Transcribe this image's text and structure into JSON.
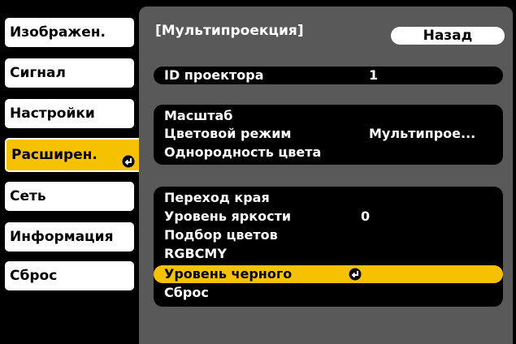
{
  "tabs": [
    {
      "label": "Изображен.",
      "active": false
    },
    {
      "label": "Сигнал",
      "active": false
    },
    {
      "label": "Настройки",
      "active": false
    },
    {
      "label": "Расширен.",
      "active": true
    },
    {
      "label": "Сеть",
      "active": false
    },
    {
      "label": "Информация",
      "active": false
    },
    {
      "label": "Сброс",
      "active": false
    }
  ],
  "panel": {
    "title": "[Мультипроекция]",
    "back_label": "Назад",
    "groups": [
      {
        "rows": [
          {
            "label": "ID проектора",
            "value": "1"
          }
        ]
      },
      {
        "rows": [
          {
            "label": "Масштаб",
            "value": ""
          },
          {
            "label": "Цветовой режим",
            "value": "Мультипрое..."
          },
          {
            "label": "Однородность цвета",
            "value": ""
          }
        ]
      },
      {
        "rows": [
          {
            "label": "Переход края",
            "value": ""
          },
          {
            "label": "Уровень яркости",
            "value": "0"
          },
          {
            "label": "Подбор цветов",
            "value": ""
          },
          {
            "label": "RGBCMY",
            "value": ""
          },
          {
            "label": "Уровень черного",
            "value": "",
            "selected": true
          },
          {
            "label": "Сброс",
            "value": ""
          }
        ]
      }
    ]
  },
  "colors": {
    "highlight": "#f5c100",
    "panel_bg": "#595959",
    "screen_bg": "#000000",
    "text": "#ffffff"
  },
  "icons": {
    "enter": "enter-icon"
  }
}
